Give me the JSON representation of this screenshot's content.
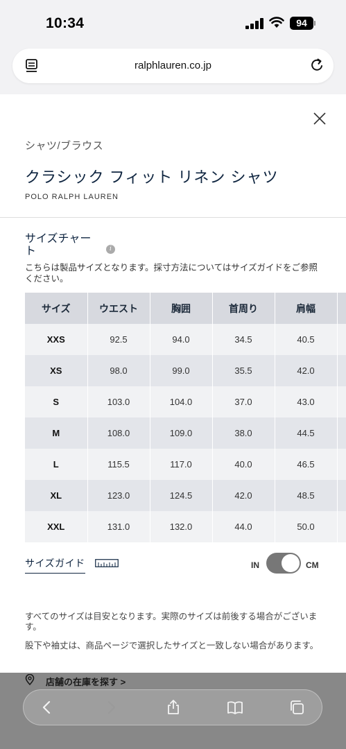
{
  "status_bar": {
    "time": "10:34",
    "battery": "94"
  },
  "browser": {
    "url": "ralphlauren.co.jp"
  },
  "product": {
    "category": "シャツ/ブラウス",
    "title": "クラシック フィット リネン シャツ",
    "brand": "POLO RALPH LAUREN"
  },
  "size_chart": {
    "title": "サイズチャート",
    "note": "こちらは製品サイズとなります。採寸方法についてはサイズガイドをご参照ください。",
    "headers": [
      "サイズ",
      "ウエスト",
      "胸囲",
      "首周り",
      "肩幅",
      ""
    ],
    "rows": [
      [
        "XXS",
        "92.5",
        "94.0",
        "34.5",
        "40.5"
      ],
      [
        "XS",
        "98.0",
        "99.0",
        "35.5",
        "42.0"
      ],
      [
        "S",
        "103.0",
        "104.0",
        "37.0",
        "43.0"
      ],
      [
        "M",
        "108.0",
        "109.0",
        "38.0",
        "44.5"
      ],
      [
        "L",
        "115.5",
        "117.0",
        "40.0",
        "46.5"
      ],
      [
        "XL",
        "123.0",
        "124.5",
        "42.0",
        "48.5"
      ],
      [
        "XXL",
        "131.0",
        "132.0",
        "44.0",
        "50.0"
      ]
    ]
  },
  "size_guide": {
    "label": "サイズガイド"
  },
  "unit_toggle": {
    "left": "IN",
    "right": "CM",
    "selected": "CM"
  },
  "disclaimers": [
    "すべてのサイズは目安となります。実際のサイズは前後する場合がございます。",
    "股下や袖丈は、商品ページで選択したサイズと一致しない場合があります。"
  ],
  "store_link": {
    "label": "店舗の在庫を探す >"
  },
  "toolbar": {
    "icons": [
      "back-icon",
      "forward-icon",
      "share-icon",
      "bookmarks-icon",
      "tabs-icon"
    ]
  },
  "colors": {
    "navy": "#0f2540",
    "header_bg": "#d7d9df",
    "toggle": "#777777"
  }
}
